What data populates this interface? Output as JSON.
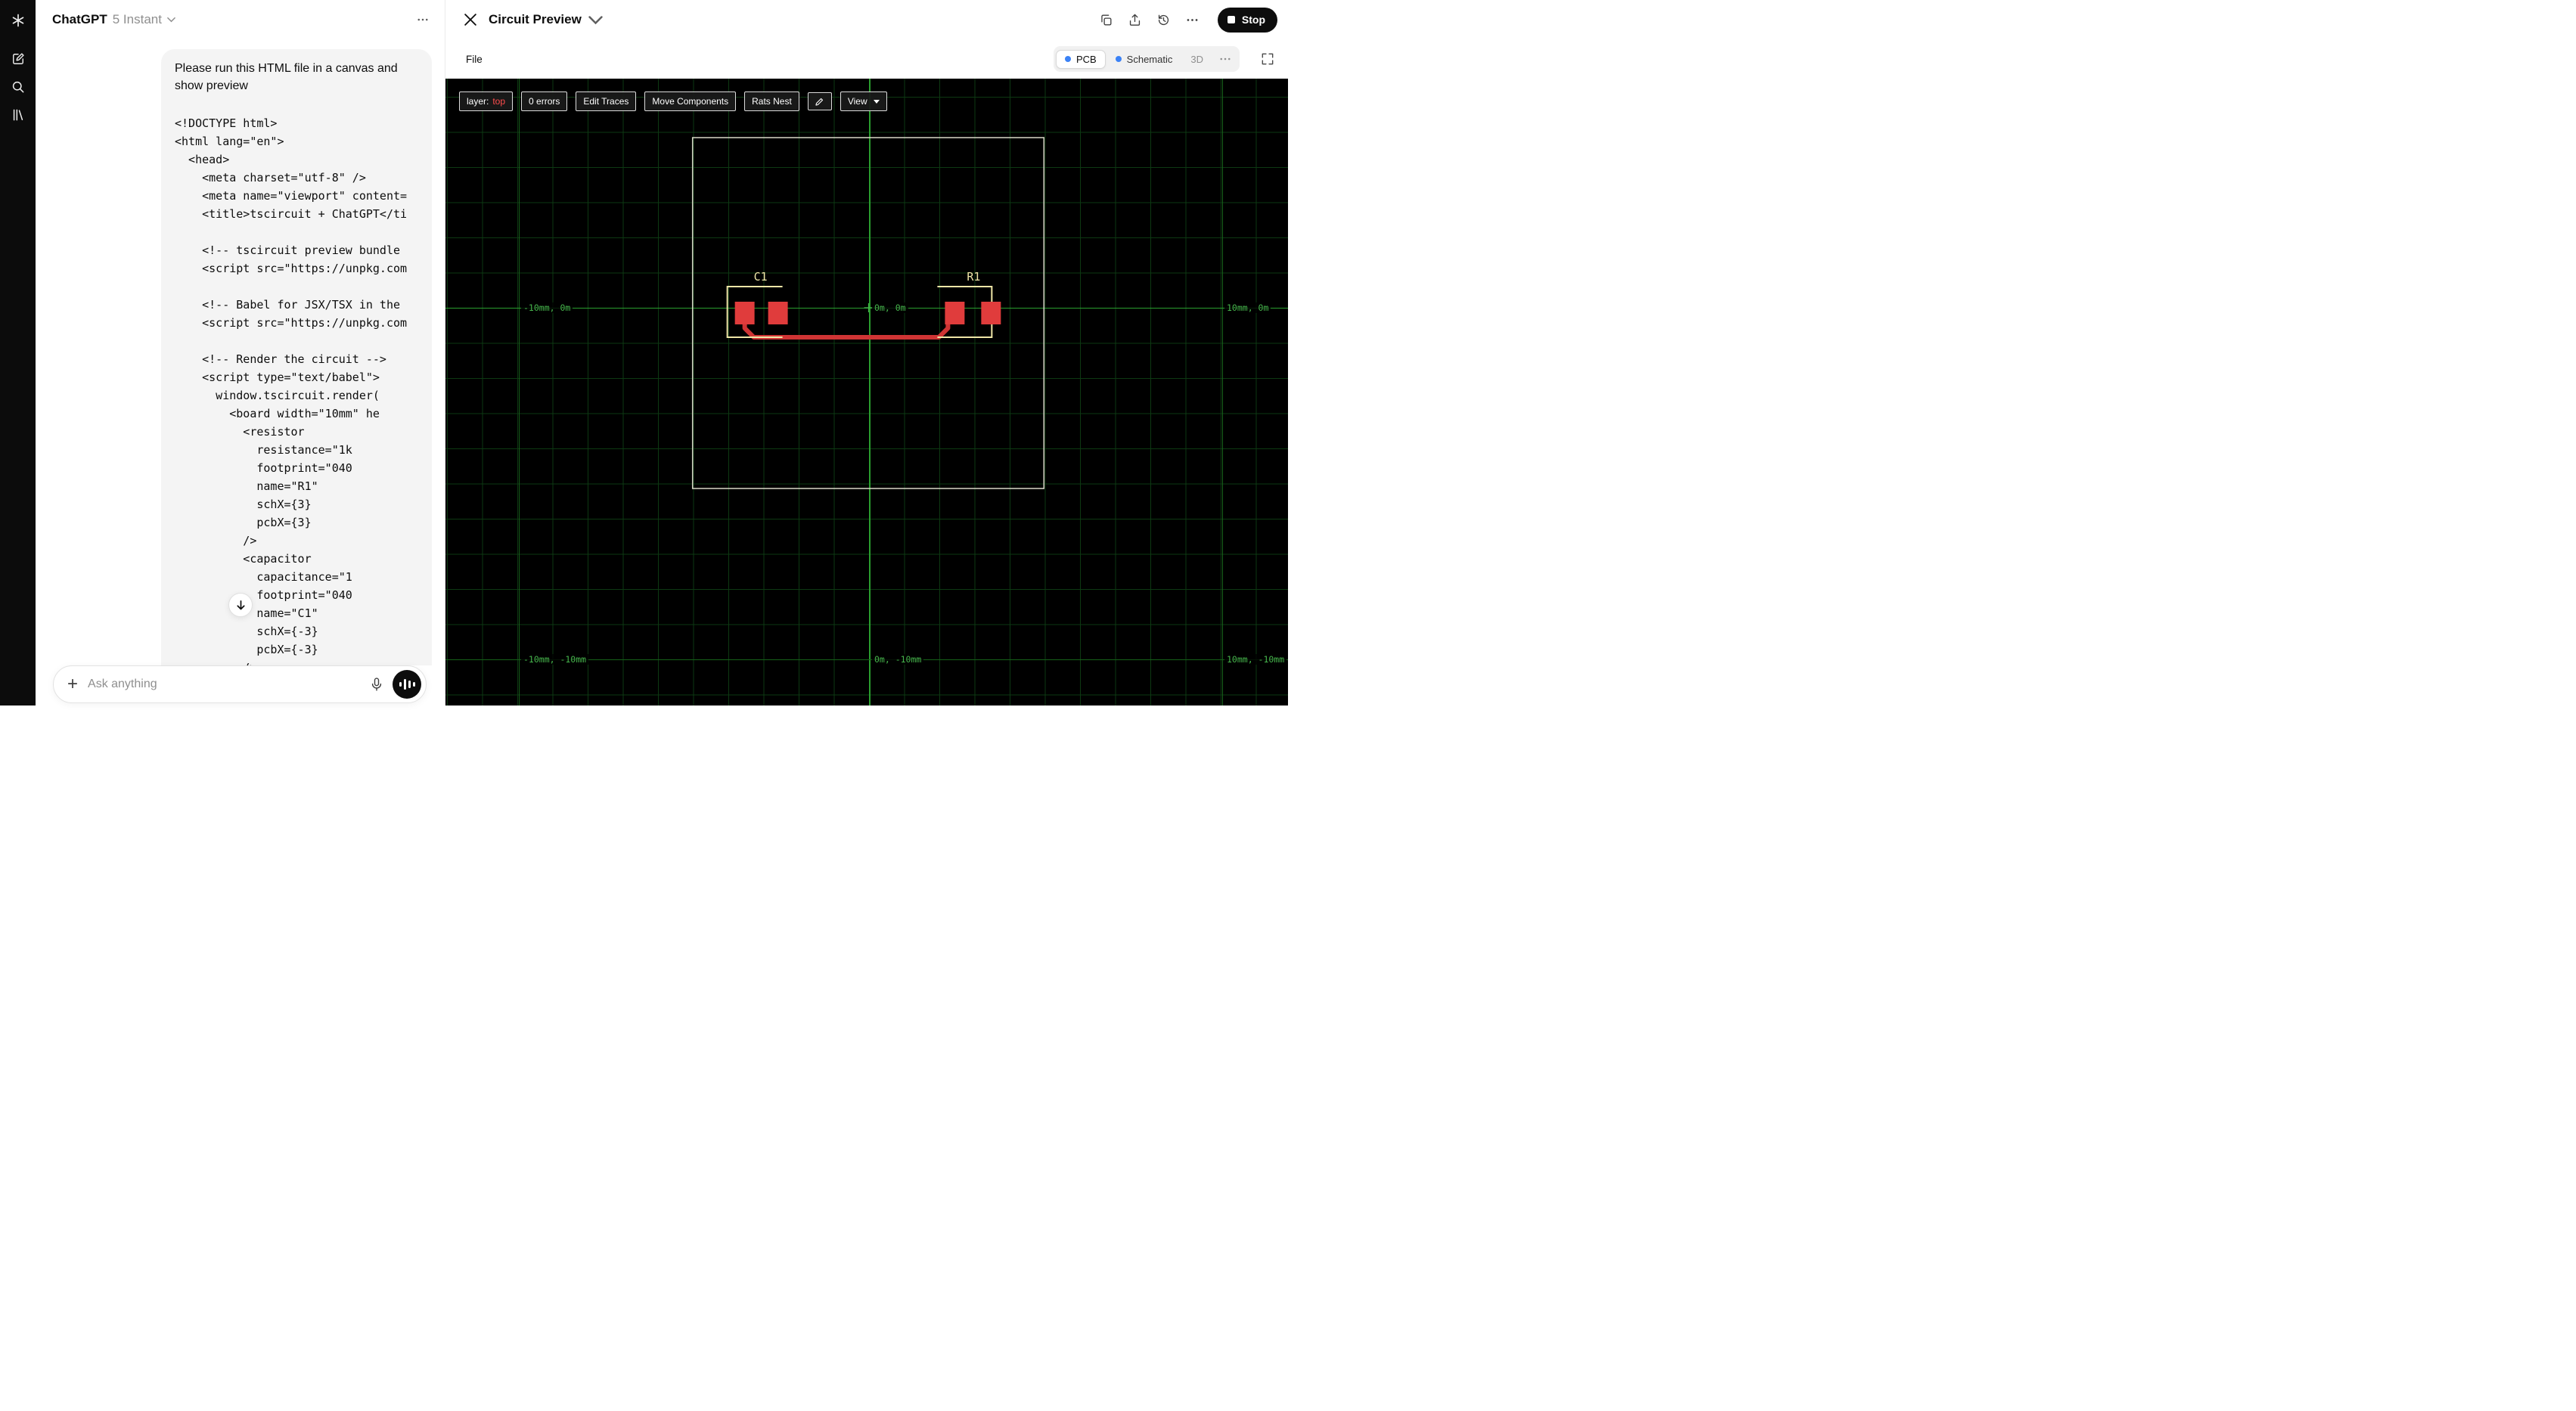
{
  "app": {
    "accent_blue": "#3b82f6",
    "icons": [
      "chatgpt-logo",
      "new-chat",
      "search",
      "library",
      "more-horizontal",
      "chevron-down",
      "close",
      "copy",
      "share-upload",
      "history",
      "stop-square",
      "fullscreen",
      "pencil",
      "caret-down",
      "plus",
      "microphone",
      "voice-waveform",
      "scroll-down-arrow"
    ]
  },
  "chat": {
    "header": {
      "title": "ChatGPT",
      "model": "5 Instant"
    },
    "message": {
      "intro": "Please run this HTML file in a canvas and show preview",
      "code": "<!DOCTYPE html>\n<html lang=\"en\">\n  <head>\n    <meta charset=\"utf-8\" />\n    <meta name=\"viewport\" content=\n    <title>tscircuit + ChatGPT</ti\n\n    <!-- tscircuit preview bundle\n    <script src=\"https://unpkg.com\n\n    <!-- Babel for JSX/TSX in the\n    <script src=\"https://unpkg.com\n\n    <!-- Render the circuit -->\n    <script type=\"text/babel\">\n      window.tscircuit.render(\n        <board width=\"10mm\" he\n          <resistor\n            resistance=\"1k\n            footprint=\"040\n            name=\"R1\"\n            schX={3}\n            pcbX={3}\n          />\n          <capacitor\n            capacitance=\"1\n            footprint=\"040\n            name=\"C1\"\n            schX={-3}\n            pcbX={-3}\n          />"
    },
    "composer": {
      "placeholder": "Ask anything"
    }
  },
  "preview": {
    "title": "Circuit Preview",
    "stop_label": "Stop",
    "menu": {
      "file": "File"
    },
    "tabs": {
      "pcb": "PCB",
      "schematic": "Schematic",
      "threed": "3D"
    },
    "pcb": {
      "toolbar": {
        "layer_label": "layer:",
        "layer_value": "top",
        "errors": "0 errors",
        "edit_traces": "Edit Traces",
        "move_components": "Move Components",
        "rats_nest": "Rats Nest",
        "view": "View"
      },
      "grid_labels": {
        "left_mid": "-10mm, 0m",
        "center_mid": "0m, 0m",
        "right_mid": "10mm, 0m",
        "left_bottom": "-10mm, -10mm",
        "center_bottom": "0m, -10mm",
        "right_bottom": "10mm, -10mm"
      },
      "components": {
        "c1": "C1",
        "r1": "R1"
      },
      "colors": {
        "grid": "#0d3912",
        "axis": "#2a9e2e",
        "label": "#46b54c",
        "pad": "#e03c3c",
        "trace": "#cf3434",
        "silkscreen": "#efe6a7",
        "board_outline": "#d9d9c8"
      }
    }
  }
}
